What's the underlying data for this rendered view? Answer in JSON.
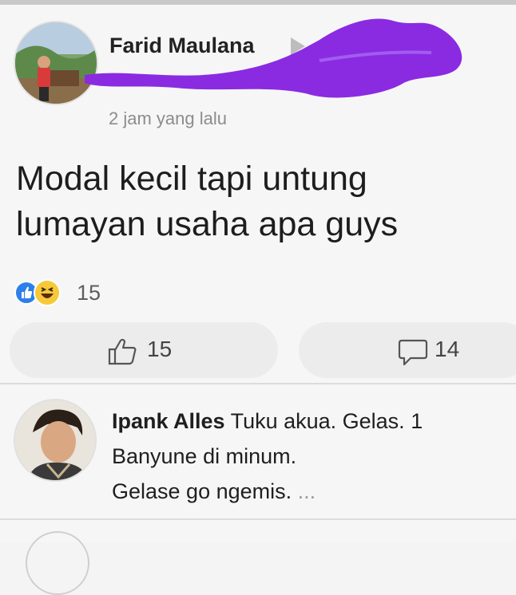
{
  "post": {
    "author": "Farid Maulana",
    "time": "2 jam yang lalu",
    "content_line1": "Modal kecil tapi untung",
    "content_line2": "lumayan usaha apa guys",
    "reaction_count": "15",
    "like_count": "15",
    "comment_count": "14"
  },
  "comment": {
    "author": "Ipank Alles",
    "text_line1": "Tuku akua.  Gelas. 1",
    "text_line2": "Banyune di minum.",
    "text_line3": "Gelase go ngemis.",
    "more": "..."
  },
  "colors": {
    "redaction": "#8a2be2",
    "like_blue": "#2e7fe8",
    "haha_yellow": "#f7c938"
  },
  "icons": {
    "share": "share-arrow-icon",
    "like": "thumbs-up-icon",
    "comment": "comment-bubble-icon"
  }
}
